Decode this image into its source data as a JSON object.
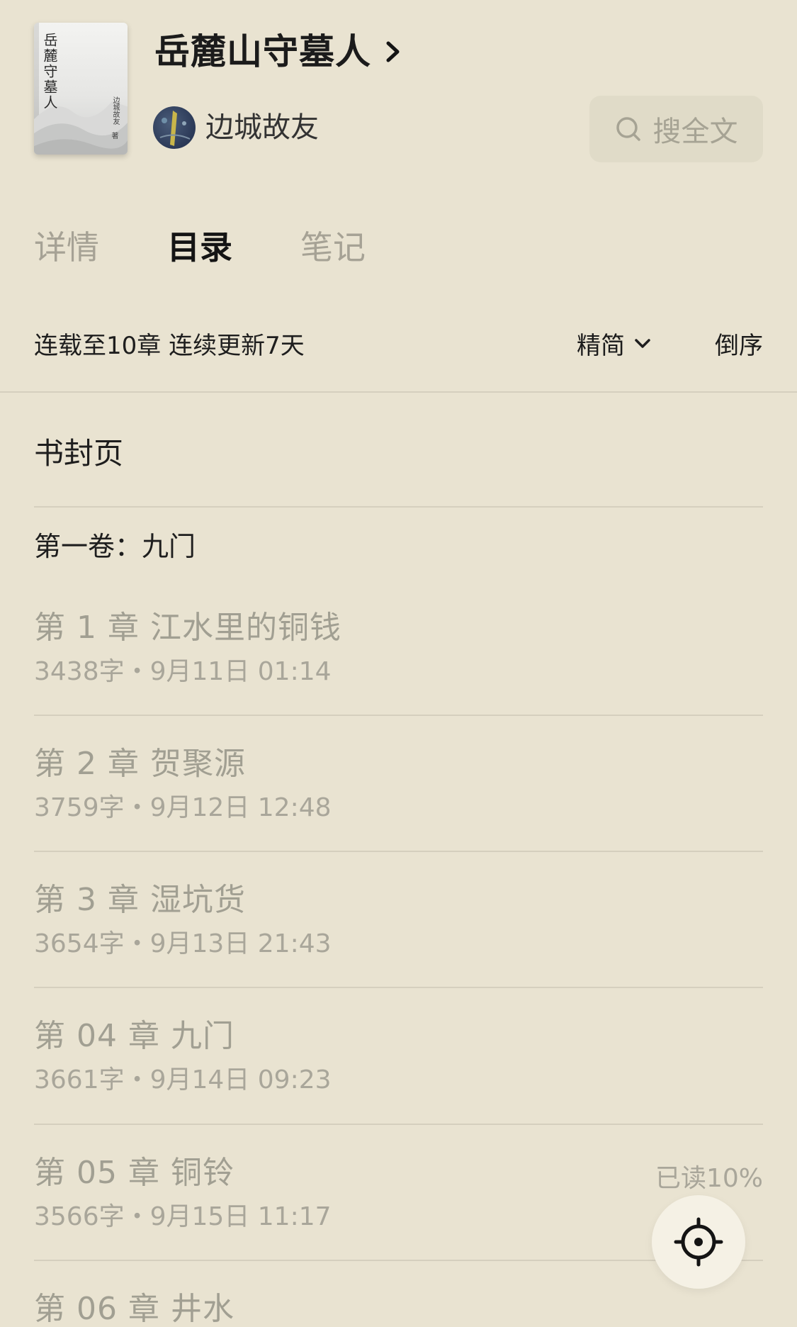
{
  "book": {
    "title": "岳麓山守墓人",
    "cover_title": "岳麓守墓人",
    "cover_author": "边城故友",
    "cover_author_suffix": "著",
    "author": "边城故友"
  },
  "search": {
    "label": "搜全文"
  },
  "tabs": [
    {
      "label": "详情",
      "active": false
    },
    {
      "label": "目录",
      "active": true
    },
    {
      "label": "笔记",
      "active": false
    }
  ],
  "status": {
    "serial_text": "连载至10章 连续更新7天",
    "view_mode": "精简",
    "sort_label": "倒序"
  },
  "cover_page_label": "书封页",
  "volume_label": "第一卷：九门",
  "chapters": [
    {
      "title": "第 1 章  江水里的铜钱",
      "meta": "3438字・9月11日 01:14",
      "progress": ""
    },
    {
      "title": "第 2 章  贺聚源",
      "meta": "3759字・9月12日 12:48",
      "progress": ""
    },
    {
      "title": "第 3 章  湿坑货",
      "meta": "3654字・9月13日 21:43",
      "progress": ""
    },
    {
      "title": "第 04 章  九门",
      "meta": "3661字・9月14日 09:23",
      "progress": ""
    },
    {
      "title": "第 05 章  铜铃",
      "meta": "3566字・9月15日 11:17",
      "progress": "已读10%"
    },
    {
      "title": "第 06 章  井水",
      "meta": "",
      "progress": ""
    }
  ],
  "colors": {
    "background": "#e9e3d1",
    "active_tab": "#141414",
    "inactive_text": "#a19f92",
    "divider": "#d5cfbe"
  }
}
